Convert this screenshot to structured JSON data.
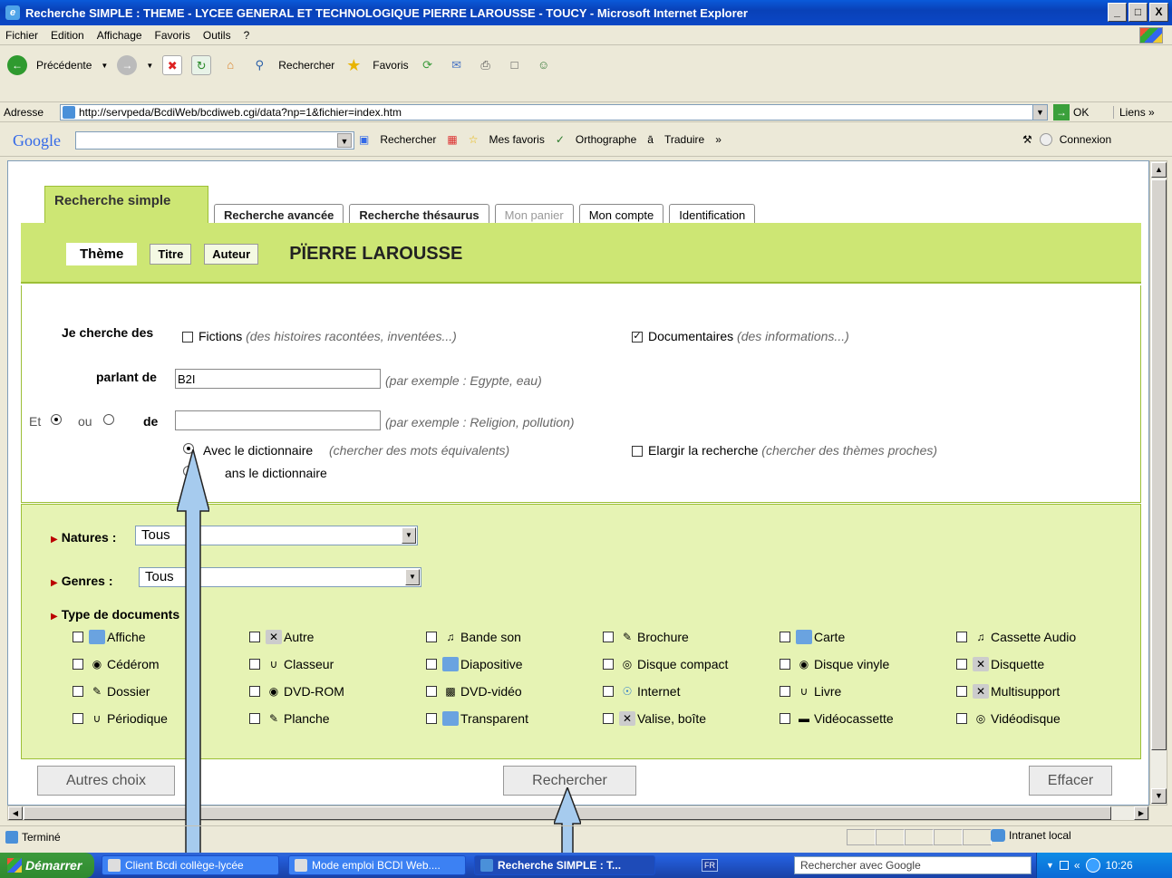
{
  "window": {
    "title": "Recherche SIMPLE : THEME - LYCEE GENERAL ET TECHNOLOGIQUE PIERRE LAROUSSE - TOUCY - Microsoft Internet Explorer",
    "controls": [
      "_",
      "□",
      "X"
    ]
  },
  "menu": [
    "Fichier",
    "Edition",
    "Affichage",
    "Favoris",
    "Outils",
    "?"
  ],
  "toolbar": {
    "back": "Précédente",
    "search": "Rechercher",
    "favorites": "Favoris"
  },
  "address": {
    "label": "Adresse",
    "url": "http://servpeda/BcdiWeb/bcdiweb.cgi/data?np=1&fichier=index.htm",
    "go": "OK",
    "links": "Liens"
  },
  "google_bar": {
    "logo": "Google",
    "search": "Rechercher",
    "favorites": "Mes favoris",
    "spell": "Orthographe",
    "translate": "Traduire",
    "more": "»",
    "login": "Connexion"
  },
  "tabs": {
    "active": "Recherche simple",
    "others": [
      {
        "label": "Recherche avancée",
        "state": "bold"
      },
      {
        "label": "Recherche thésaurus",
        "state": "bold"
      },
      {
        "label": "Mon panier",
        "state": "dim"
      },
      {
        "label": "Mon compte",
        "state": "norm"
      },
      {
        "label": "Identification",
        "state": "norm"
      }
    ]
  },
  "subtabs": {
    "theme": "Thème",
    "titre": "Titre",
    "auteur": "Auteur",
    "heading": "PÏERRE LAROUSSE"
  },
  "search_form": {
    "je_cherche": "Je cherche des",
    "fictions": "Fictions",
    "fictions_hint": "(des histoires racontées, inventées...)",
    "fictions_checked": false,
    "documentaires": "Documentaires",
    "documentaires_hint": "(des informations...)",
    "documentaires_checked": true,
    "parlant_de": "parlant de",
    "parlant_value": "B2I",
    "parlant_hint": "(par exemple : Egypte, eau)",
    "et": "Et",
    "ou": "ou",
    "de": "de",
    "de_value": "",
    "de_hint": "(par exemple : Religion, pollution)",
    "avec_dict": "Avec le dictionnaire",
    "avec_dict_hint": "(chercher des mots équivalents)",
    "sans_dict": "ans le dictionnaire",
    "elargir": "Elargir la recherche",
    "elargir_hint": "(chercher des thèmes proches)"
  },
  "filters": {
    "natures_label": "Natures :",
    "natures_value": "Tous",
    "genres_label": "Genres :",
    "genres_value": "Tous",
    "types_label": "Type de documents",
    "types": [
      [
        "Affiche",
        "Autre",
        "Bande son",
        "Brochure",
        "Carte",
        "Cassette Audio"
      ],
      [
        "Cédérom",
        "Classeur",
        "Diapositive",
        "Disque compact",
        "Disque vinyle",
        "Disquette"
      ],
      [
        "Dossier",
        "DVD-ROM",
        "DVD-vidéo",
        "Internet",
        "Livre",
        "Multisupport"
      ],
      [
        "Périodique",
        "Planche",
        "Transparent",
        "Valise, boîte",
        "Vidéocassette",
        "Vidéodisque"
      ]
    ]
  },
  "buttons": {
    "autres": "Autres choix",
    "rechercher": "Rechercher",
    "effacer": "Effacer"
  },
  "status": {
    "text": "Terminé",
    "zone": "Intranet local"
  },
  "taskbar": {
    "start": "Démarrer",
    "items": [
      "Client Bcdi collège-lycée",
      "Mode emploi BCDI Web....",
      "Recherche SIMPLE : T..."
    ],
    "lang": "FR",
    "search_placeholder": "Rechercher avec Google",
    "time": "10:26"
  }
}
